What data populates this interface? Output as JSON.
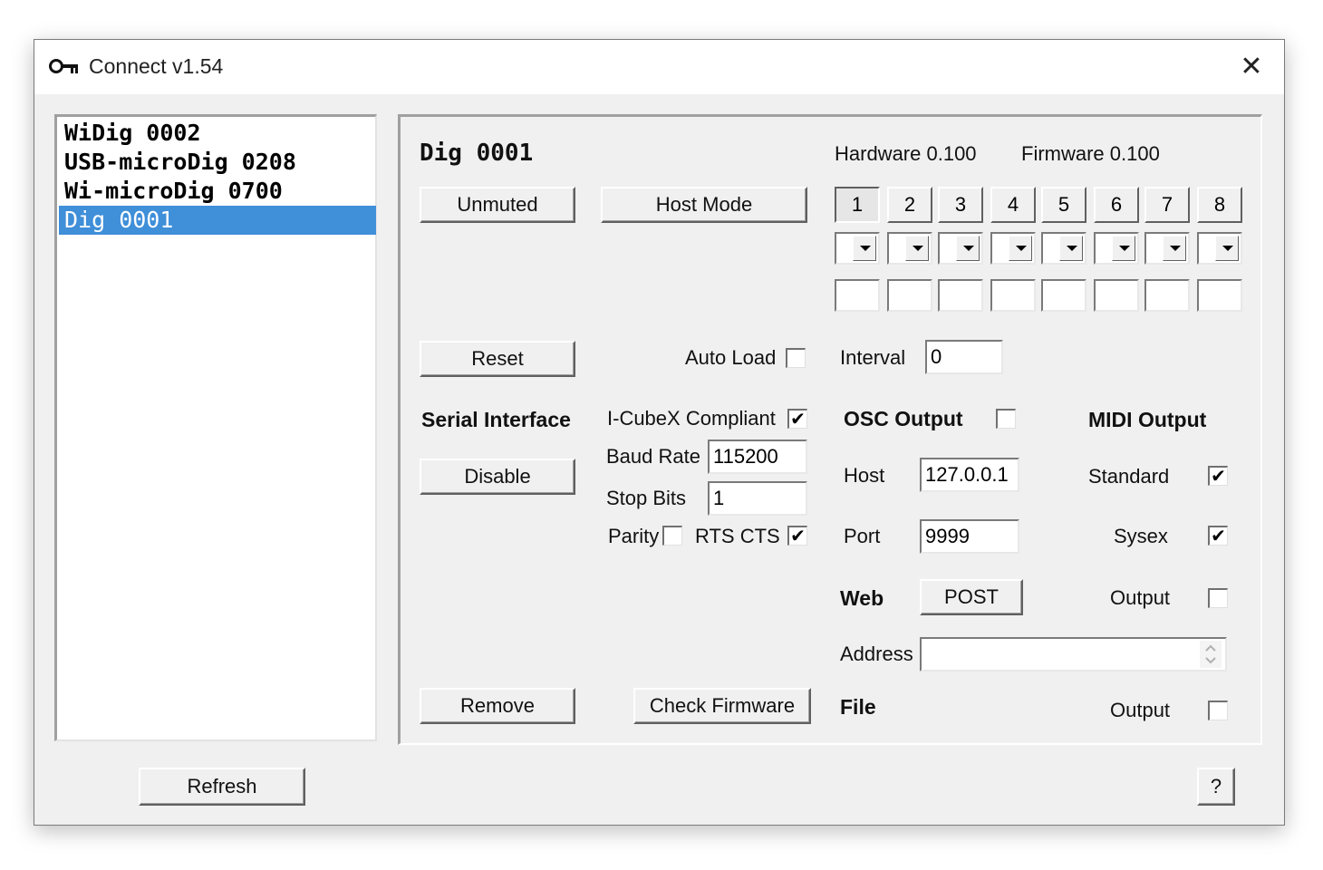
{
  "window": {
    "title": "Connect v1.54",
    "close_symbol": "✕",
    "app_icon": "key-icon"
  },
  "device_list": {
    "items": [
      "WiDig 0002",
      "USB-microDig 0208",
      "Wi-microDig 0700",
      "Dig 0001"
    ],
    "selected_index": 3,
    "selected_color": "#3f8fd9"
  },
  "device": {
    "name": "Dig 0001",
    "hardware": "Hardware 0.100",
    "firmware": "Firmware 0.100"
  },
  "buttons": {
    "unmuted": "Unmuted",
    "host_mode": "Host Mode",
    "reset": "Reset",
    "disable": "Disable",
    "remove": "Remove",
    "check_firmware": "Check Firmware",
    "post": "POST",
    "refresh": "Refresh",
    "help": "?"
  },
  "channels": {
    "labels": [
      "1",
      "2",
      "3",
      "4",
      "5",
      "6",
      "7",
      "8"
    ],
    "active": "1"
  },
  "auto_load": {
    "label": "Auto Load",
    "checked": false
  },
  "interval": {
    "label": "Interval",
    "value": "0"
  },
  "serial": {
    "heading": "Serial Interface",
    "icubex_label": "I-CubeX Compliant",
    "icubex_checked": true,
    "baud_label": "Baud Rate",
    "baud_value": "115200",
    "stop_label": "Stop Bits",
    "stop_value": "1",
    "parity_label": "Parity",
    "parity_checked": false,
    "rts_label": "RTS CTS",
    "rts_checked": true
  },
  "osc": {
    "heading": "OSC Output",
    "checked": false,
    "host_label": "Host",
    "host_value": "127.0.0.1",
    "port_label": "Port",
    "port_value": "9999"
  },
  "midi": {
    "heading": "MIDI Output",
    "standard_label": "Standard",
    "standard_checked": true,
    "sysex_label": "Sysex",
    "sysex_checked": true
  },
  "web": {
    "heading": "Web",
    "output_label": "Output",
    "output_checked": false,
    "address_label": "Address",
    "address_value": ""
  },
  "file": {
    "heading": "File",
    "output_label": "Output",
    "output_checked": false
  }
}
